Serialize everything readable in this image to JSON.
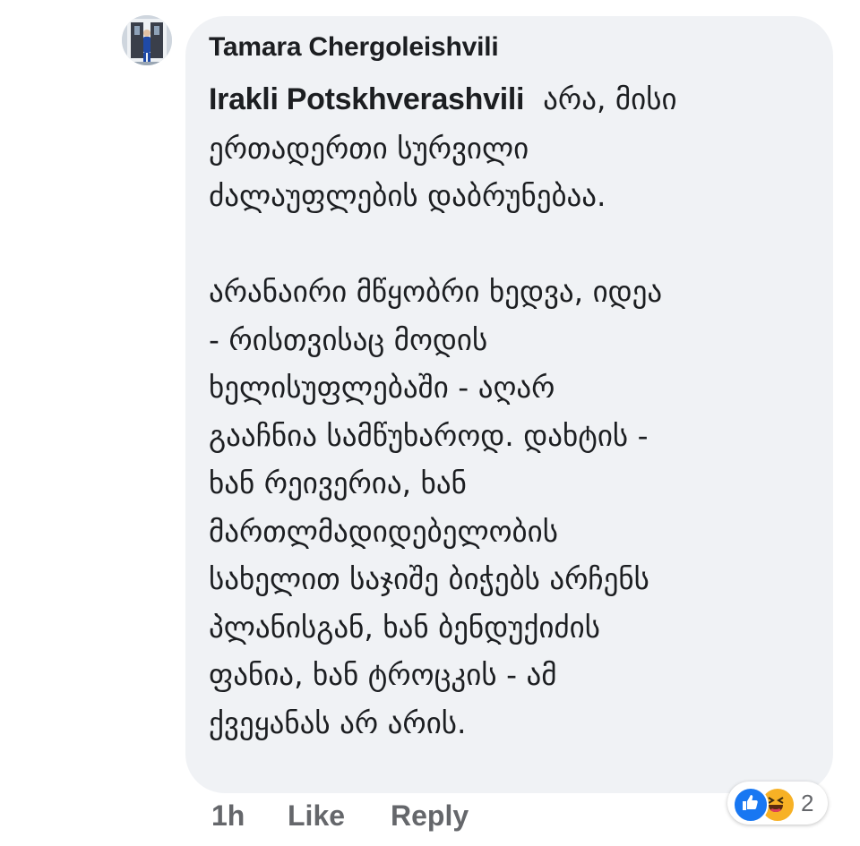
{
  "comment": {
    "author": "Tamara Chergoleishvili",
    "mention": "Irakli Potskhverashvili",
    "lines": [
      "არა, მისი",
      "ერთადერთი სურვილი",
      "ძალაუფლების დაბრუნებაა.",
      "",
      "არანაირი მწყობრი ხედვა, იდეა",
      "- რისთვისაც მოდის",
      "ხელისუფლებაში - აღარ",
      "გააჩნია სამწუხაროდ. დახტის -",
      "ხან რეივერია, ხან",
      "მართლმადიდებელობის",
      "სახელით საჯიშე ბიჭებს არჩენს",
      "პლანისგან, ხან ბენდუქიძის",
      "ფანია, ხან ტროცკის - ამ",
      "ქვეყანას არ არის."
    ]
  },
  "actions": {
    "timestamp": "1h",
    "like": "Like",
    "reply": "Reply"
  },
  "reactions": {
    "icons": [
      "like-reaction-icon",
      "haha-reaction-icon"
    ],
    "count": "2",
    "colors": {
      "like": "#1877f2",
      "haha": "#f7b125"
    }
  },
  "colors": {
    "bubble": "#f0f2f5",
    "text": "#1c1e21",
    "meta": "#65676b"
  }
}
